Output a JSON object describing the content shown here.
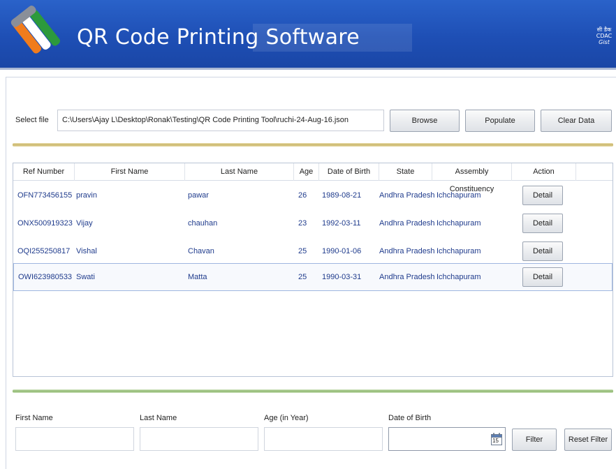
{
  "app": {
    "title": "QR Code Printing Software",
    "brand_lines": [
      "सी डैक",
      "CDAC",
      "Gist"
    ]
  },
  "file": {
    "label": "Select file",
    "path": "C:\\Users\\Ajay L\\Desktop\\Ronak\\Testing\\QR Code Printing Tool\\ruchi-24-Aug-16.json",
    "browse_label": "Browse",
    "populate_label": "Populate",
    "clear_label": "Clear Data"
  },
  "grid": {
    "columns": [
      "Ref Number",
      "First Name",
      "Last Name",
      "Age",
      "Date of Birth",
      "State",
      "Assembly Constituency",
      "Action"
    ],
    "rows": [
      {
        "ref": "OFN773456155",
        "first": "pravin",
        "last": "pawar",
        "age": "26",
        "dob": "1989-08-21",
        "state": "Andhra Pradesh",
        "ac": "Ichchapuram",
        "action": "Detail"
      },
      {
        "ref": "ONX500919323",
        "first": "Vijay",
        "last": "chauhan",
        "age": "23",
        "dob": "1992-03-11",
        "state": "Andhra Pradesh",
        "ac": "Ichchapuram",
        "action": "Detail"
      },
      {
        "ref": "OQI255250817",
        "first": "Vishal",
        "last": "Chavan",
        "age": "25",
        "dob": "1990-01-06",
        "state": "Andhra Pradesh",
        "ac": "Ichchapuram",
        "action": "Detail"
      },
      {
        "ref": "OWI623980533",
        "first": "Swati",
        "last": "Matta",
        "age": "25",
        "dob": "1990-03-31",
        "state": "Andhra Pradesh",
        "ac": "Ichchapuram",
        "action": "Detail"
      }
    ]
  },
  "filter": {
    "first_name_label": "First Name",
    "last_name_label": "Last Name",
    "age_label": "Age (in Year)",
    "dob_label": "Date of Birth",
    "calendar_day": "15",
    "filter_label": "Filter",
    "reset_label": "Reset Filter"
  },
  "colors": {
    "header_blue": "#1e4fb5",
    "row_text": "#1f3b8c",
    "gold_separator": "#c9b56a",
    "green_separator": "#8cb66c"
  }
}
